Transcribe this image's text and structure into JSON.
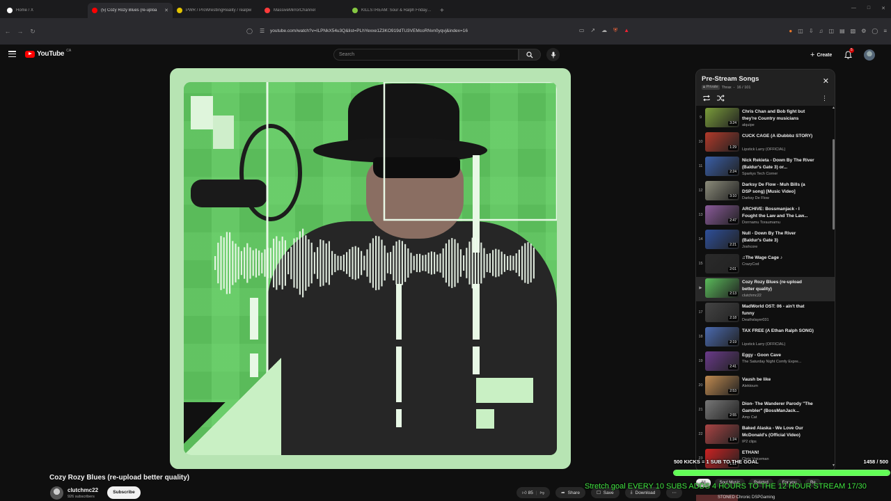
{
  "browser": {
    "tabs": [
      {
        "title": "Home / X",
        "favicon": "x-logo-icon",
        "color": "#ffffff"
      },
      {
        "title": "(5) Cozy Rozy Blues (re-uploa",
        "favicon": "youtube-icon",
        "color": "#ff0000",
        "active": true
      },
      {
        "title": "PWR / ProWrestlingReality / realpw",
        "favicon": "pwr-icon",
        "color": "#e3c400"
      },
      {
        "title": "MassiveMirrorChannel",
        "favicon": "massive-icon",
        "color": "#ff3b3b"
      },
      {
        "title": "KILLSTREAM: Sour & Ralph Friday Fu",
        "favicon": "rumble-play-icon",
        "color": "#85c742"
      }
    ],
    "url": "youtube.com/watch?v=ILPNkX54u3Q&list=PLhYexxe1Z3KO919dTU3VEMcoRNvn0yqvj&index=16"
  },
  "header": {
    "logo_text": "YouTube",
    "region": "CA",
    "search_placeholder": "Search",
    "create_label": "Create",
    "notification_count": "5"
  },
  "video": {
    "title": "Cozy Rozy Blues (re-upload better quality)",
    "channel": "clutchmc22",
    "subscribers": "926 subscribers",
    "subscribe_label": "Subscribe",
    "likes": "85",
    "share_label": "Share",
    "save_label": "Save",
    "download_label": "Download"
  },
  "playlist": {
    "title": "Pre-Stream Songs",
    "privacy": "Private",
    "owner": "Thrax",
    "position": "16 / 101",
    "items": [
      {
        "index": "9",
        "title": "Chris Chan and Bob fight but they're Country musicians",
        "channel": "alquipe",
        "duration": "3:24",
        "thumb": "#7a9c3a"
      },
      {
        "index": "10",
        "title": "CUCK CAGE (A iDubbbz STORY)",
        "channel": "Lipstick Larry (OFFICIAL)",
        "duration": "1:29",
        "thumb": "#b23a2a"
      },
      {
        "index": "11",
        "title": "Nick Rekieta - Down By The River (Baldur's Gate 3) or...",
        "channel": "Sparkys Tech Corner",
        "duration": "2:24",
        "thumb": "#3a5fa8"
      },
      {
        "index": "12",
        "title": "Darksy De Flow - Muh Bills (a DSP song) [Music Video]",
        "channel": "Darksy De Flow",
        "duration": "3:10",
        "thumb": "#8b8b7a"
      },
      {
        "index": "13",
        "title": "ARCHIVE: Bossmanjack - I Fought the Law and The Law...",
        "channel": "Dorrnamu Toraumamu",
        "duration": "2:47",
        "thumb": "#8a5a9a"
      },
      {
        "index": "14",
        "title": "Null - Down By The River (Baldur's Gate 3)",
        "channel": "Joshcore",
        "duration": "2:21",
        "thumb": "#2e4f9a"
      },
      {
        "index": "15",
        "title": "♫The Wage Cage ♪",
        "channel": "CrazyCod",
        "duration": "2:01",
        "thumb": "#2a2a2a",
        "single": true
      },
      {
        "index": "",
        "title": "Cozy Rozy Blues (re-upload better quality)",
        "channel": "clutchmc22",
        "duration": "2:13",
        "thumb": "#5abb5a",
        "current": true
      },
      {
        "index": "17",
        "title": "MadWorld OST: 06 - ain't that funny",
        "channel": "Deathslayer031",
        "duration": "2:18",
        "thumb": "#444444"
      },
      {
        "index": "18",
        "title": "TAX FREE (A Ethan Ralph SONG)",
        "channel": "Lipstick Larry (OFFICIAL)",
        "duration": "2:19",
        "thumb": "#4a6ab0"
      },
      {
        "index": "19",
        "title": "Eggy - Goon Cave",
        "channel": "The Saturday Night Comfy Expre...",
        "duration": "2:41",
        "thumb": "#6a3a8a",
        "single": true
      },
      {
        "index": "20",
        "title": "Vaush be like",
        "channel": "Alektoum",
        "duration": "2:53",
        "thumb": "#c08a50",
        "single": true
      },
      {
        "index": "21",
        "title": "Dion- The Wanderer Parody \"The Gambler\" (BossManJack...",
        "channel": "Amp Cat",
        "duration": "2:55",
        "thumb": "#777777"
      },
      {
        "index": "22",
        "title": "Baked Alaska - We Love Our McDonald's (Official Video)",
        "channel": "IP2 clips",
        "duration": "1:24",
        "thumb": "#aa4444"
      },
      {
        "index": "23",
        "title": "ETHAN!",
        "channel": "Chris Voiceman",
        "duration": "1:31",
        "thumb": "#cc2222",
        "single": true
      }
    ],
    "partial_item_title": "LEON!"
  },
  "overlay": {
    "goal_label": "500 KICKS = 1 SUB TO THE GOAL",
    "goal_count": "1458 / 500",
    "goal_progress": 1.0,
    "stretch_text": "Stretch goal EVERY 10 SUBS ADDS 4 HOURS TO THE 12 HOUR STREAM 17/30"
  },
  "chips": [
    "All",
    "Soul Music",
    "Related",
    "For you",
    "Re"
  ],
  "next_channel": "STONED Chronic DSPGaming",
  "colors": {
    "accent": "#ff0000",
    "goal": "#62ff56",
    "stretch": "#43e743",
    "artwork_green": "#5abb5a"
  }
}
